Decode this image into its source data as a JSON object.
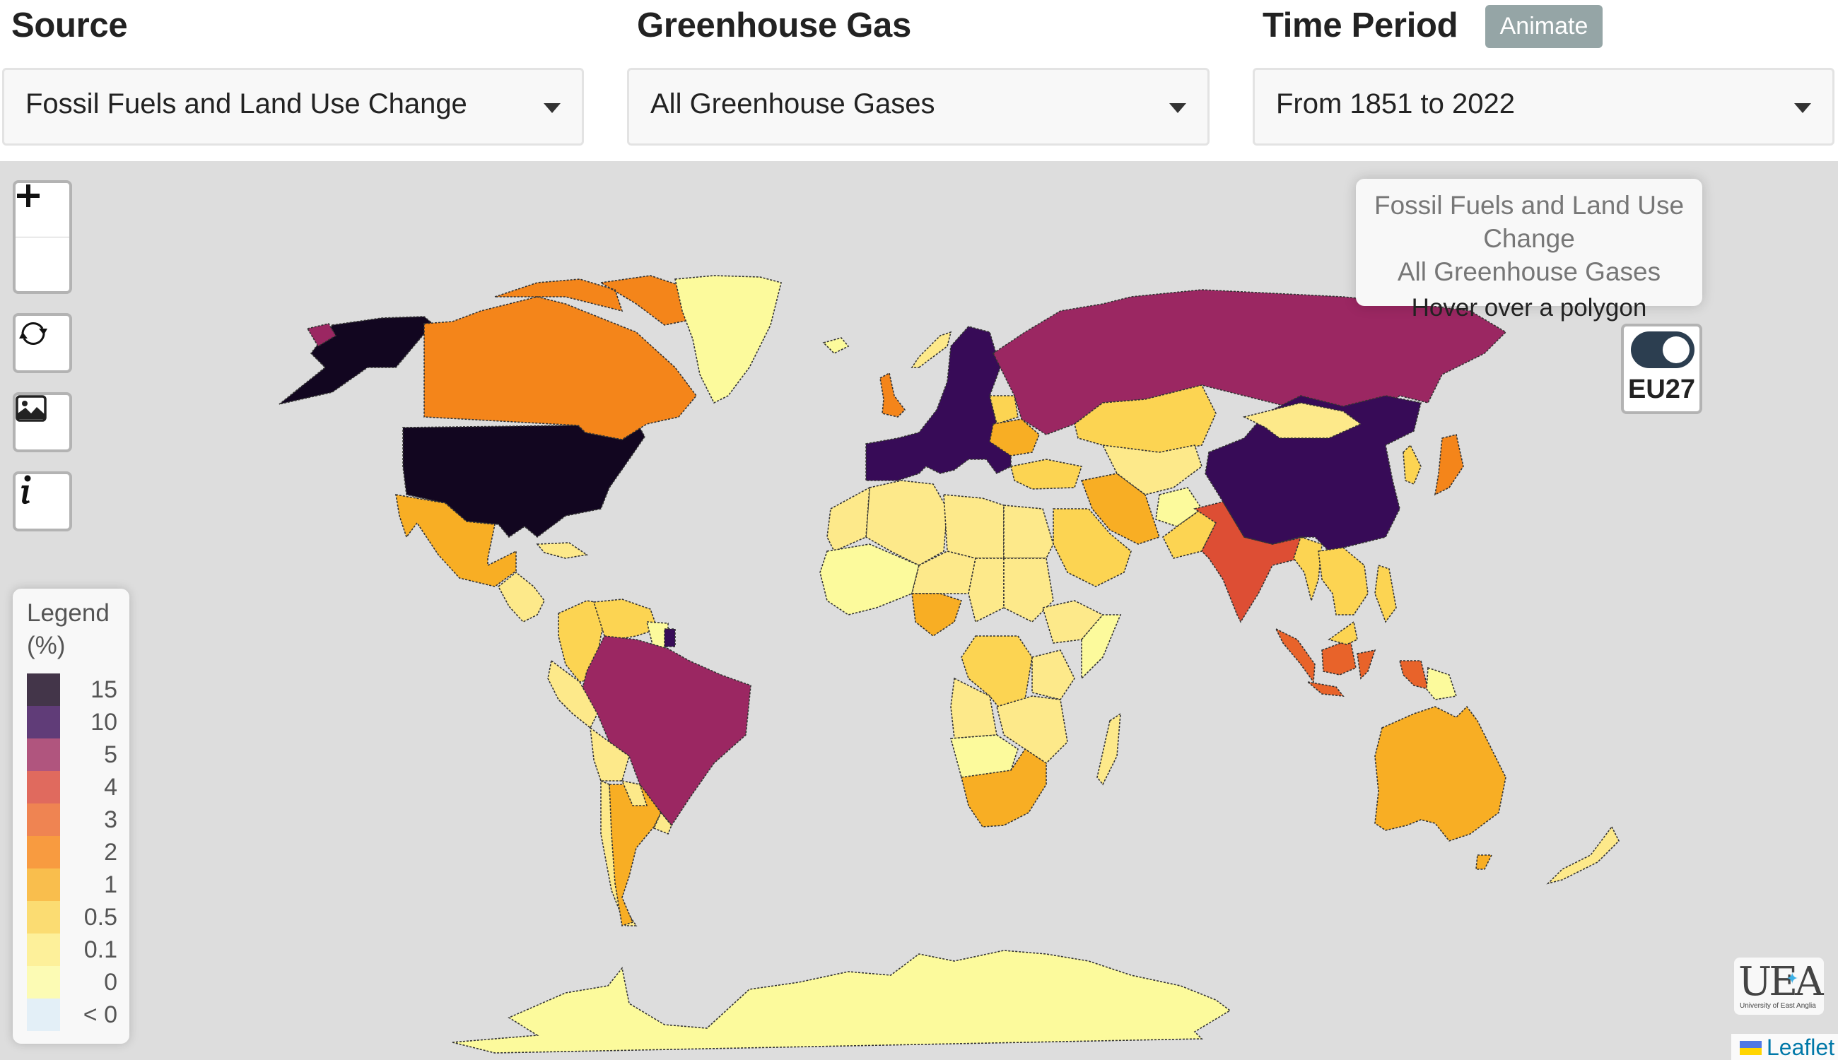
{
  "header": {
    "source": {
      "label": "Source",
      "selected": "Fossil Fuels and Land Use Change"
    },
    "gas": {
      "label": "Greenhouse Gas",
      "selected": "All Greenhouse Gases"
    },
    "period": {
      "label": "Time Period",
      "selected": "From 1851 to 2022",
      "animate_label": "Animate"
    }
  },
  "controls": {
    "zoom_in": "+",
    "zoom_out": "−",
    "icons": [
      "plus-icon",
      "minus-icon",
      "refresh-icon",
      "image-icon",
      "info-icon"
    ]
  },
  "info_box": {
    "line1": "Fossil Fuels and Land Use Change",
    "line2": "All Greenhouse Gases",
    "hint": "Hover over a polygon"
  },
  "eu_toggle": {
    "label": "EU27",
    "on": true
  },
  "legend": {
    "title_line1": "Legend",
    "title_line2": "(%)",
    "items": [
      {
        "label": "15",
        "color": "#433549"
      },
      {
        "label": "10",
        "color": "#603c78"
      },
      {
        "label": "5",
        "color": "#b0557e"
      },
      {
        "label": "4",
        "color": "#e06a5e"
      },
      {
        "label": "3",
        "color": "#ef8452"
      },
      {
        "label": "2",
        "color": "#f89b40"
      },
      {
        "label": "1",
        "color": "#f9be4d"
      },
      {
        "label": "0.5",
        "color": "#fbdc72"
      },
      {
        "label": "0.1",
        "color": "#fdf09a"
      },
      {
        "label": "0",
        "color": "#fcfbb4"
      },
      {
        "label": "< 0",
        "color": "#e3eff7"
      }
    ]
  },
  "map_colors": {
    "ge15": "#120620",
    "ge10": "#370b57",
    "ge5": "#9b2762",
    "ge4": "#dd4e34",
    "ge3": "#e8632a",
    "ge2": "#f4851a",
    "ge1": "#f8ae24",
    "ge05": "#fcd452",
    "ge01": "#fde98a",
    "ge0": "#fcfa9c",
    "background": "#dddddd"
  },
  "countries": [
    {
      "name": "United States",
      "class": "ge15"
    },
    {
      "name": "Alaska (US)",
      "class": "ge15"
    },
    {
      "name": "Canada",
      "class": "ge2"
    },
    {
      "name": "Mexico",
      "class": "ge1"
    },
    {
      "name": "Greenland",
      "class": "ge0"
    },
    {
      "name": "Central America",
      "class": "ge01"
    },
    {
      "name": "Cuba",
      "class": "ge01"
    },
    {
      "name": "Colombia",
      "class": "ge05"
    },
    {
      "name": "Venezuela",
      "class": "ge05"
    },
    {
      "name": "Guyana/Suriname",
      "class": "ge0"
    },
    {
      "name": "French Guiana (EU)",
      "class": "ge10"
    },
    {
      "name": "Brazil",
      "class": "ge5"
    },
    {
      "name": "Peru",
      "class": "ge01"
    },
    {
      "name": "Bolivia",
      "class": "ge01"
    },
    {
      "name": "Chile",
      "class": "ge01"
    },
    {
      "name": "Argentina",
      "class": "ge1"
    },
    {
      "name": "Uruguay",
      "class": "ge01"
    },
    {
      "name": "Paraguay",
      "class": "ge01"
    },
    {
      "name": "EU27",
      "class": "ge10"
    },
    {
      "name": "United Kingdom",
      "class": "ge2"
    },
    {
      "name": "Norway",
      "class": "ge01"
    },
    {
      "name": "Iceland",
      "class": "ge0"
    },
    {
      "name": "Belarus",
      "class": "ge05"
    },
    {
      "name": "Ukraine",
      "class": "ge1"
    },
    {
      "name": "Russia",
      "class": "ge5"
    },
    {
      "name": "Chukotka (Russia)",
      "class": "ge5"
    },
    {
      "name": "Kazakhstan",
      "class": "ge05"
    },
    {
      "name": "Turkey",
      "class": "ge05"
    },
    {
      "name": "Iran",
      "class": "ge1"
    },
    {
      "name": "Saudi Arabia",
      "class": "ge05"
    },
    {
      "name": "Central Asia",
      "class": "ge01"
    },
    {
      "name": "Afghanistan",
      "class": "ge0"
    },
    {
      "name": "Pakistan",
      "class": "ge05"
    },
    {
      "name": "India",
      "class": "ge4"
    },
    {
      "name": "China",
      "class": "ge10"
    },
    {
      "name": "Mongolia",
      "class": "ge01"
    },
    {
      "name": "Korea",
      "class": "ge05"
    },
    {
      "name": "Japan",
      "class": "ge2"
    },
    {
      "name": "Myanmar",
      "class": "ge05"
    },
    {
      "name": "Thailand/Indochina",
      "class": "ge05"
    },
    {
      "name": "Philippines",
      "class": "ge05"
    },
    {
      "name": "Indonesia (Sumatra)",
      "class": "ge3"
    },
    {
      "name": "Indonesia (Borneo)",
      "class": "ge3"
    },
    {
      "name": "Indonesia (Java)",
      "class": "ge3"
    },
    {
      "name": "Indonesia (Sulawesi)",
      "class": "ge3"
    },
    {
      "name": "Indonesia (Papua)",
      "class": "ge3"
    },
    {
      "name": "Papua New Guinea",
      "class": "ge0"
    },
    {
      "name": "Malaysia (Borneo)",
      "class": "ge05"
    },
    {
      "name": "Australia",
      "class": "ge1"
    },
    {
      "name": "Tasmania",
      "class": "ge1"
    },
    {
      "name": "New Zealand",
      "class": "ge01"
    },
    {
      "name": "North Africa (Algeria)",
      "class": "ge01"
    },
    {
      "name": "Morocco",
      "class": "ge01"
    },
    {
      "name": "Libya",
      "class": "ge01"
    },
    {
      "name": "Egypt",
      "class": "ge01"
    },
    {
      "name": "West Africa (Mali/Mauritania)",
      "class": "ge0"
    },
    {
      "name": "Niger",
      "class": "ge01"
    },
    {
      "name": "Chad",
      "class": "ge01"
    },
    {
      "name": "Sudan",
      "class": "ge01"
    },
    {
      "name": "Nigeria",
      "class": "ge1"
    },
    {
      "name": "Ethiopia",
      "class": "ge01"
    },
    {
      "name": "Somalia",
      "class": "ge0"
    },
    {
      "name": "DR Congo",
      "class": "ge05"
    },
    {
      "name": "Angola",
      "class": "ge01"
    },
    {
      "name": "Tanzania",
      "class": "ge01"
    },
    {
      "name": "Zambia/Mozambique",
      "class": "ge01"
    },
    {
      "name": "Namibia/Botswana",
      "class": "ge0"
    },
    {
      "name": "South Africa",
      "class": "ge1"
    },
    {
      "name": "Madagascar",
      "class": "ge01"
    },
    {
      "name": "Antarctica",
      "class": "ge0"
    }
  ],
  "branding": {
    "uea_mark": "UEA",
    "uea_sub": "University of East Anglia",
    "attribution": "Leaflet"
  }
}
